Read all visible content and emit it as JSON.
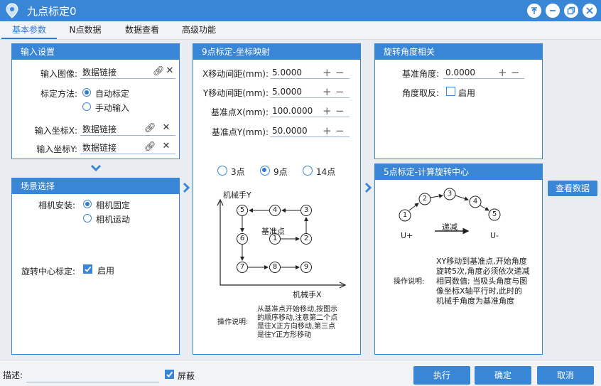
{
  "window": {
    "title": "九点标定0"
  },
  "tabs": [
    "基本参数",
    "N点数据",
    "数据查看",
    "高级功能"
  ],
  "input_panel": {
    "title": "输入设置",
    "image_label": "输入图像:",
    "image_value": "数据链接",
    "method_label": "标定方法:",
    "method_auto": "自动标定",
    "method_manual": "手动输入",
    "x_label": "输入坐标X:",
    "x_value": "数据链接",
    "y_label": "输入坐标Y:",
    "y_value": "数据链接"
  },
  "scene_panel": {
    "title": "场景选择",
    "camera_label": "相机安装:",
    "camera_fixed": "相机固定",
    "camera_moving": "相机运动",
    "rotcenter_label": "旋转中心标定:",
    "rotcenter_value": "启用"
  },
  "mapping_panel": {
    "title": "9点标定-坐标映射",
    "x_step_label": "X移动间距(mm):",
    "x_step": "5.0000",
    "y_step_label": "Y移动间距(mm):",
    "y_step": "5.0000",
    "base_x_label": "基准点X(mm):",
    "base_x": "100.0000",
    "base_y_label": "基准点Y(mm):",
    "base_y": "50.0000",
    "opt_3": "3点",
    "opt_9": "9点",
    "opt_14": "14点",
    "diagram": {
      "y_axis": "机械手Y",
      "x_axis": "机械手X",
      "base_label": "基准点",
      "points": [
        "1",
        "2",
        "3",
        "4",
        "5",
        "6",
        "7",
        "8",
        "9"
      ],
      "note_title": "操作说明:",
      "note_lines": [
        "从基准点开始移动,按图示",
        "的顺序移动,注意第二个点",
        "是往X正方向移动,第三点",
        "是往Y正方形移动"
      ]
    }
  },
  "rotation_panel": {
    "title": "旋转角度相关",
    "base_angle_label": "基准角度:",
    "base_angle": "0.0000",
    "invert_label": "角度取反:",
    "invert_value": "启用"
  },
  "five_panel": {
    "title": "5点标定-计算旋转中心",
    "points": [
      "1",
      "2",
      "3",
      "4",
      "5"
    ],
    "decrease": "递减",
    "u_plus": "U+",
    "u_minus": "U-",
    "note_title": "操作说明:",
    "note_lines": [
      "XY移动到基准点,开始角度",
      "旋转5次,角度必须依次递减",
      "相同数值; 当吸头角度与图",
      "像坐标X轴平行时,此时的",
      "机械手角度为基准角度"
    ]
  },
  "view_data_button": "查看数据",
  "footer": {
    "desc_label": "描述:",
    "mask_label": "屏蔽",
    "execute": "执行",
    "confirm": "确定",
    "cancel": "取消"
  }
}
